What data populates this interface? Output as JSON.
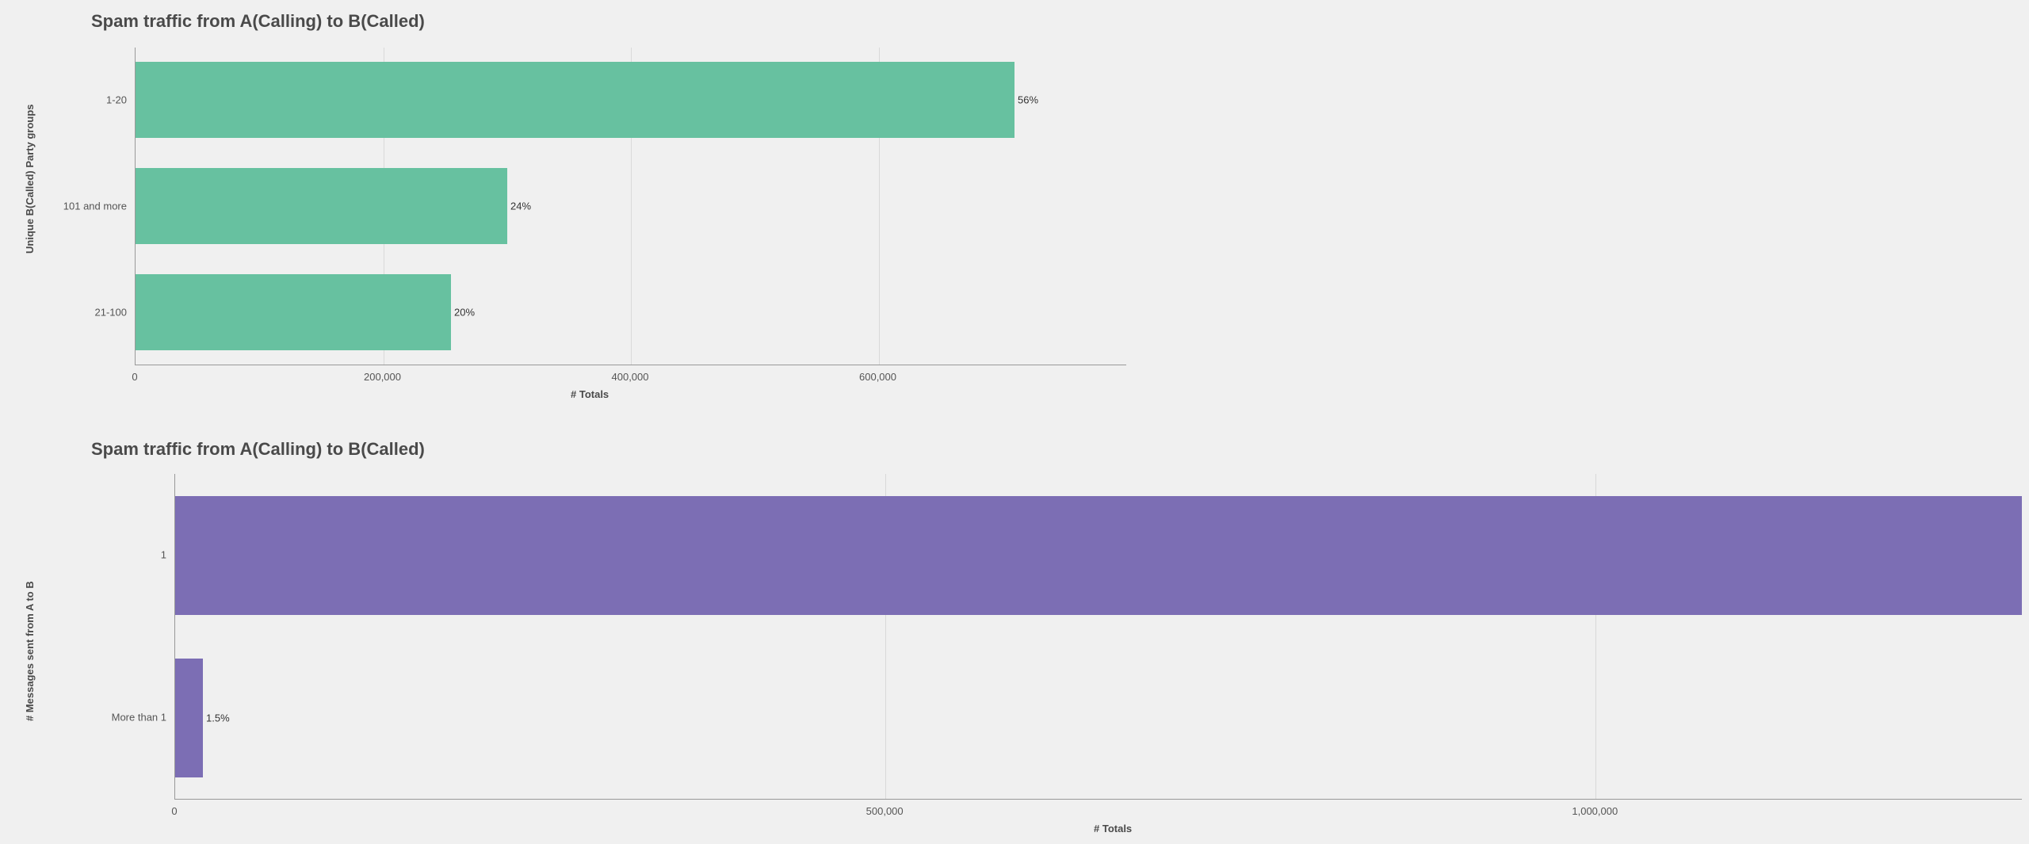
{
  "chart_data": [
    {
      "type": "bar",
      "orientation": "horizontal",
      "title": "Spam traffic from A(Calling) to B(Called)",
      "xlabel": "# Totals",
      "ylabel": "Unique B(Called) Party groups",
      "xlim": [
        0,
        800000
      ],
      "categories": [
        "1-20",
        "101 and more",
        "21-100"
      ],
      "values": [
        710000,
        300000,
        255000
      ],
      "data_labels": [
        "56%",
        "24%",
        "20%"
      ],
      "x_ticks": [
        0,
        200000,
        400000,
        600000
      ],
      "x_tick_labels": [
        "0",
        "200,000",
        "400,000",
        "600,000"
      ],
      "color": "#67c1a0"
    },
    {
      "type": "bar",
      "orientation": "horizontal",
      "title": "Spam traffic from A(Calling) to B(Called)",
      "xlabel": "# Totals",
      "ylabel": "# Messages sent from A to B",
      "xlim": [
        0,
        1300000
      ],
      "categories": [
        "1",
        "More than 1"
      ],
      "values": [
        1300000,
        19500
      ],
      "data_labels": [
        "",
        "1.5%"
      ],
      "x_ticks": [
        0,
        500000,
        1000000
      ],
      "x_tick_labels": [
        "0",
        "500,000",
        "1,000,000"
      ],
      "color": "#7c6eb4"
    }
  ],
  "chart1": {
    "title": "Spam traffic from A(Calling) to B(Called)",
    "ylabel": "Unique B(Called) Party groups",
    "xlabel": "# Totals",
    "cat0": "1-20",
    "cat1": "101 and more",
    "cat2": "21-100",
    "lbl0": "56%",
    "lbl1": "24%",
    "lbl2": "20%",
    "xt0": "0",
    "xt1": "200,000",
    "xt2": "400,000",
    "xt3": "600,000"
  },
  "chart2": {
    "title": "Spam traffic from A(Calling) to B(Called)",
    "ylabel": "# Messages sent from A to B",
    "xlabel": "# Totals",
    "cat0": "1",
    "cat1": "More than 1",
    "lbl1": "1.5%",
    "xt0": "0",
    "xt1": "500,000",
    "xt2": "1,000,000"
  }
}
